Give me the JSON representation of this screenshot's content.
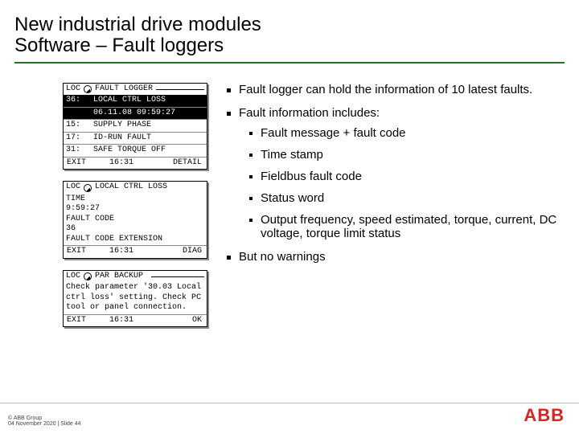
{
  "title": {
    "line1": "New industrial drive modules",
    "line2": "Software – Fault loggers"
  },
  "panel1": {
    "loc": "LOC",
    "header": "FAULT LOGGER",
    "rows": [
      {
        "id": "36:",
        "text": "LOCAL CTRL LOSS",
        "inv": true
      },
      {
        "id": "",
        "text": "06.11.08 09:59:27",
        "inv": true
      },
      {
        "id": "15:",
        "text": "SUPPLY PHASE",
        "inv": false
      },
      {
        "id": "17:",
        "text": "ID-RUN FAULT",
        "inv": false
      },
      {
        "id": "31:",
        "text": "SAFE TORQUE OFF",
        "inv": false
      }
    ],
    "footer": {
      "exit": "EXIT",
      "time": "16:31",
      "right": "DETAIL"
    }
  },
  "panel2": {
    "loc": "LOC",
    "header": "LOCAL CTRL LOSS",
    "body": [
      "TIME",
      "9:59:27",
      "FAULT CODE",
      "36",
      "FAULT CODE EXTENSION"
    ],
    "footer": {
      "exit": "EXIT",
      "time": "16:31",
      "right": "DIAG"
    }
  },
  "panel3": {
    "loc": "LOC",
    "header": "PAR BACKUP",
    "body": "Check parameter '30.03 Local ctrl loss' setting. Check PC tool or panel connection.",
    "footer": {
      "exit": "EXIT",
      "time": "16:31",
      "right": "OK"
    }
  },
  "bullets": [
    {
      "text": "Fault logger can hold the information of 10 latest faults."
    },
    {
      "text": "Fault information includes:",
      "children": [
        "Fault message + fault code",
        "Time stamp",
        "Fieldbus fault code",
        "Status word",
        "Output frequency, speed estimated, torque, current, DC voltage, torque limit status"
      ]
    },
    {
      "text": "But no warnings"
    }
  ],
  "footer": {
    "line1": "© ABB Group",
    "line2": "04 November 2020 | Slide 44"
  },
  "logo": "ABB"
}
